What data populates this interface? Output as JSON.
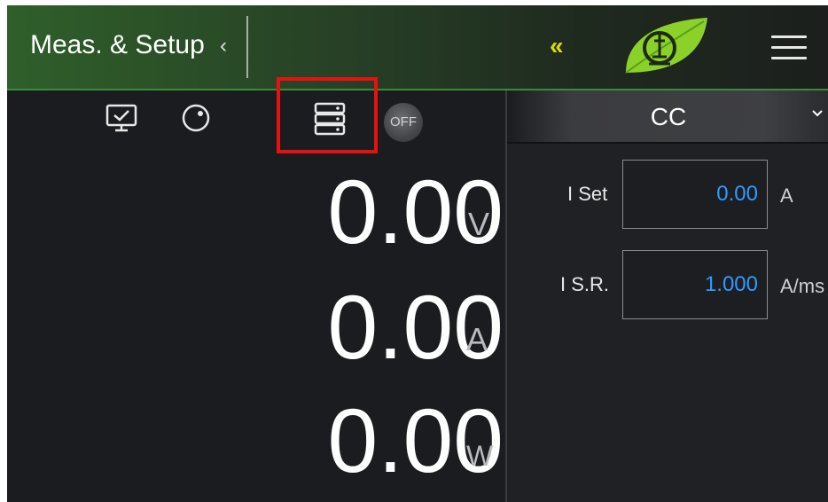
{
  "header": {
    "title": "Meas. & Setup",
    "title_chevron": "‹",
    "collapse_symbol": "«",
    "logo_icon": "leaf-omega-logo",
    "menu_icon": "hamburger-menu-icon"
  },
  "toolbar": {
    "icons": [
      "monitor-check-icon",
      "knob-icon",
      "server-stack-icon"
    ],
    "output_state": "OFF"
  },
  "readings": [
    {
      "value": "0.00",
      "unit": "V"
    },
    {
      "value": "0.00",
      "unit": "A"
    },
    {
      "value": "0.00",
      "unit": "W"
    }
  ],
  "mode": {
    "label": "CC"
  },
  "parameters": [
    {
      "label": "I Set",
      "value": "0.00",
      "unit": "A"
    },
    {
      "label": "I S.R.",
      "value": "1.000",
      "unit": "A/ms"
    }
  ],
  "colors": {
    "accent_green": "#3d8a3b",
    "collapse_yellow": "#d7e000",
    "value_blue": "#2f9bff",
    "highlight_red": "#e81010",
    "background": "#1a1c20"
  }
}
